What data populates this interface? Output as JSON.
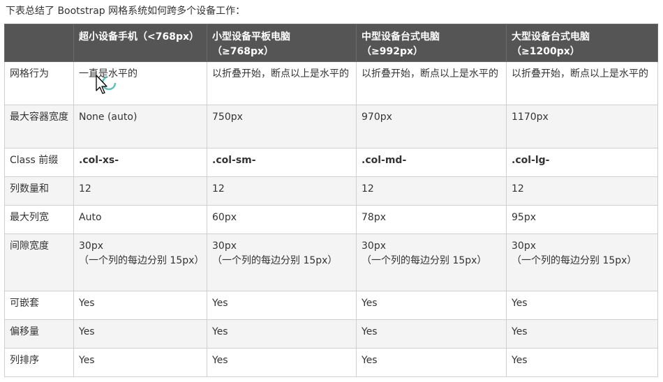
{
  "intro": "下表总结了 Bootstrap 网格系统如何跨多个设备工作：",
  "headers": [
    "",
    "超小设备手机（<768px）",
    "小型设备平板电脑\n（≥768px）",
    "中型设备台式电脑\n（≥992px）",
    "大型设备台式电脑\n（≥1200px）"
  ],
  "rows": [
    {
      "label": "网格行为",
      "cells": [
        "一直是水平的",
        "以折叠开始，断点以上是水平的",
        "以折叠开始，断点以上是水平的",
        "以折叠开始，断点以上是水平的"
      ]
    },
    {
      "label": "最大容器宽度",
      "cells": [
        "None (auto)",
        "750px",
        "970px",
        "1170px"
      ]
    },
    {
      "label": "Class 前缀",
      "cells": [
        ".col-xs-",
        ".col-sm-",
        ".col-md-",
        ".col-lg-"
      ]
    },
    {
      "label": "列数量和",
      "cells": [
        "12",
        "12",
        "12",
        "12"
      ]
    },
    {
      "label": "最大列宽",
      "cells": [
        "Auto",
        "60px",
        "78px",
        "95px"
      ]
    },
    {
      "label": "间隙宽度",
      "cells": [
        "30px\n（一个列的每边分别 15px）",
        "30px\n（一个列的每边分别 15px）",
        "30px\n（一个列的每边分别 15px）",
        "30px\n（一个列的每边分别 15px）"
      ]
    },
    {
      "label": "可嵌套",
      "cells": [
        "Yes",
        "Yes",
        "Yes",
        "Yes"
      ]
    },
    {
      "label": "偏移量",
      "cells": [
        "Yes",
        "Yes",
        "Yes",
        "Yes"
      ]
    },
    {
      "label": "列排序",
      "cells": [
        "Yes",
        "Yes",
        "Yes",
        "Yes"
      ]
    }
  ]
}
